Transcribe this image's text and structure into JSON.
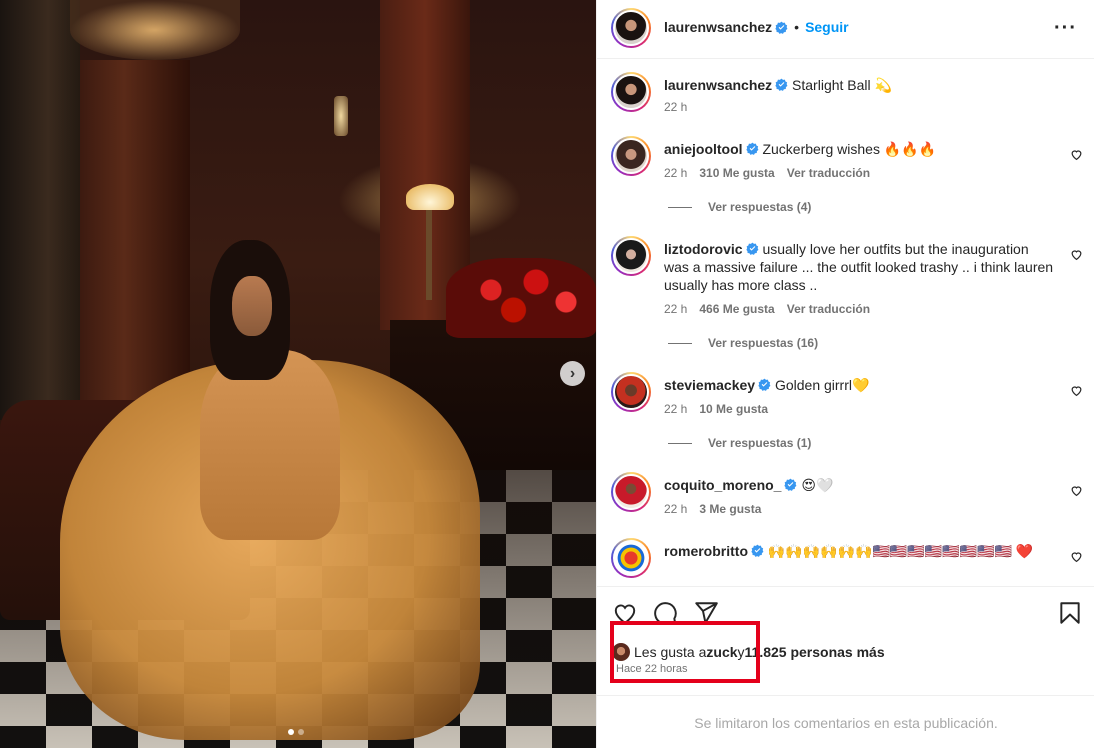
{
  "post": {
    "username": "laurenwsanchez",
    "follow_label": "Seguir",
    "more_icon": "more-horizontal-icon",
    "caption_text": "Starlight Ball 💫",
    "caption_time": "22 h",
    "carousel_next_icon": "chevron-right-icon",
    "carousel_dots": 2,
    "carousel_active": 1
  },
  "comments": [
    {
      "username": "aniejooltool",
      "text": "Zuckerberg wishes 🔥🔥🔥",
      "time": "22 h",
      "likes": "310 Me gusta",
      "translate": "Ver traducción",
      "replies": "Ver respuestas (4)"
    },
    {
      "username": "liztodorovic",
      "text": "usually love her outfits but the inauguration was a massive failure ... the outfit looked trashy .. i think lauren usually has more class ..",
      "time": "22 h",
      "likes": "466 Me gusta",
      "translate": "Ver traducción",
      "replies": "Ver respuestas (16)"
    },
    {
      "username": "steviemackey",
      "text": "Golden girrrl💛",
      "time": "22 h",
      "likes": "10 Me gusta",
      "replies": "Ver respuestas (1)"
    },
    {
      "username": "coquito_moreno_",
      "text": "😍🤍",
      "time": "22 h",
      "likes": "3 Me gusta"
    },
    {
      "username": "romerobritto",
      "text": "🙌🙌🙌🙌🙌🙌🇺🇸🇺🇸🇺🇸🇺🇸🇺🇸🇺🇸🇺🇸🇺🇸 ❤️"
    }
  ],
  "actions": {
    "like_icon": "heart-icon",
    "comment_icon": "comment-icon",
    "share_icon": "send-icon",
    "save_icon": "bookmark-icon"
  },
  "likes": {
    "prefix": "Les gusta a ",
    "liker": "zuck",
    "conjunction": " y ",
    "others": "11.825 personas más",
    "time_ago": "Hace 22 horas"
  },
  "footer": {
    "limited_text": "Se limitaron los comentarios en esta publicación."
  },
  "colors": {
    "accent": "#0095f6",
    "highlight": "#e4001b",
    "verified": "#3897f0"
  }
}
